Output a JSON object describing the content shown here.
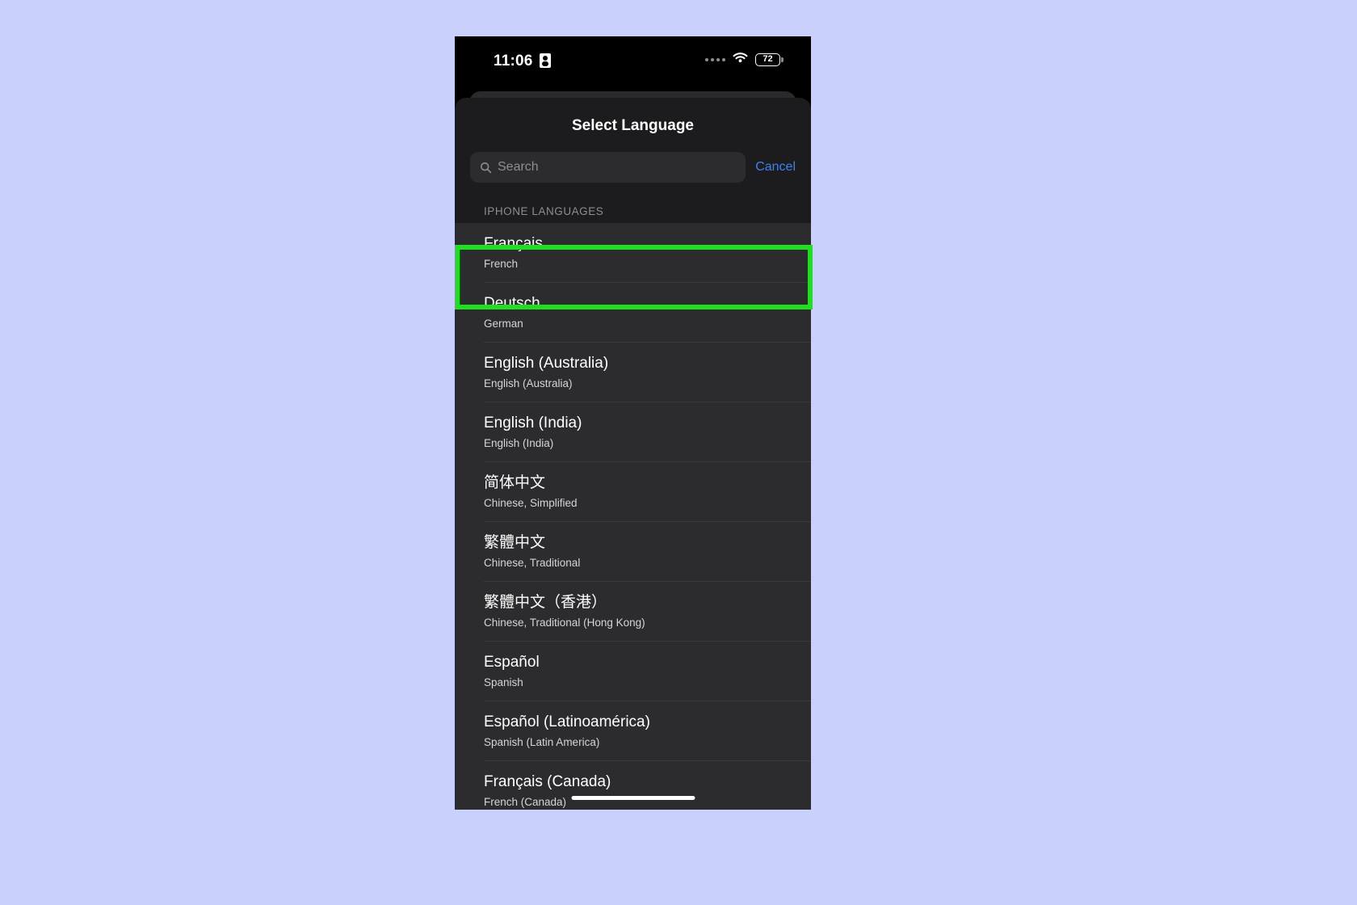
{
  "background_color": "#c9d0fb",
  "status_bar": {
    "time": "11:06",
    "lock_icon": "contact-card-icon",
    "signal_icon": "signal-dots-icon",
    "wifi_icon": "wifi-icon",
    "battery_level": "72",
    "battery_icon": "battery-icon"
  },
  "sheet": {
    "title": "Select Language",
    "search": {
      "icon": "search-icon",
      "value": "",
      "placeholder": "Search"
    },
    "cancel_label": "Cancel",
    "cancel_color": "#3b82f6",
    "section_header": "IPHONE LANGUAGES",
    "languages": [
      {
        "native": "Français",
        "english": "French",
        "highlighted": true
      },
      {
        "native": "Deutsch",
        "english": "German",
        "highlighted": false
      },
      {
        "native": "English (Australia)",
        "english": "English (Australia)",
        "highlighted": false
      },
      {
        "native": "English (India)",
        "english": "English (India)",
        "highlighted": false
      },
      {
        "native": "简体中文",
        "english": "Chinese, Simplified",
        "highlighted": false
      },
      {
        "native": "繁體中文",
        "english": "Chinese, Traditional",
        "highlighted": false
      },
      {
        "native": "繁體中文（香港）",
        "english": "Chinese, Traditional (Hong Kong)",
        "highlighted": false
      },
      {
        "native": "Español",
        "english": "Spanish",
        "highlighted": false
      },
      {
        "native": "Español (Latinoamérica)",
        "english": "Spanish (Latin America)",
        "highlighted": false
      },
      {
        "native": "Français (Canada)",
        "english": "French (Canada)",
        "highlighted": false
      }
    ]
  },
  "highlight": {
    "color": "#1fe01f",
    "target": "Français"
  },
  "home_indicator": "home-indicator"
}
